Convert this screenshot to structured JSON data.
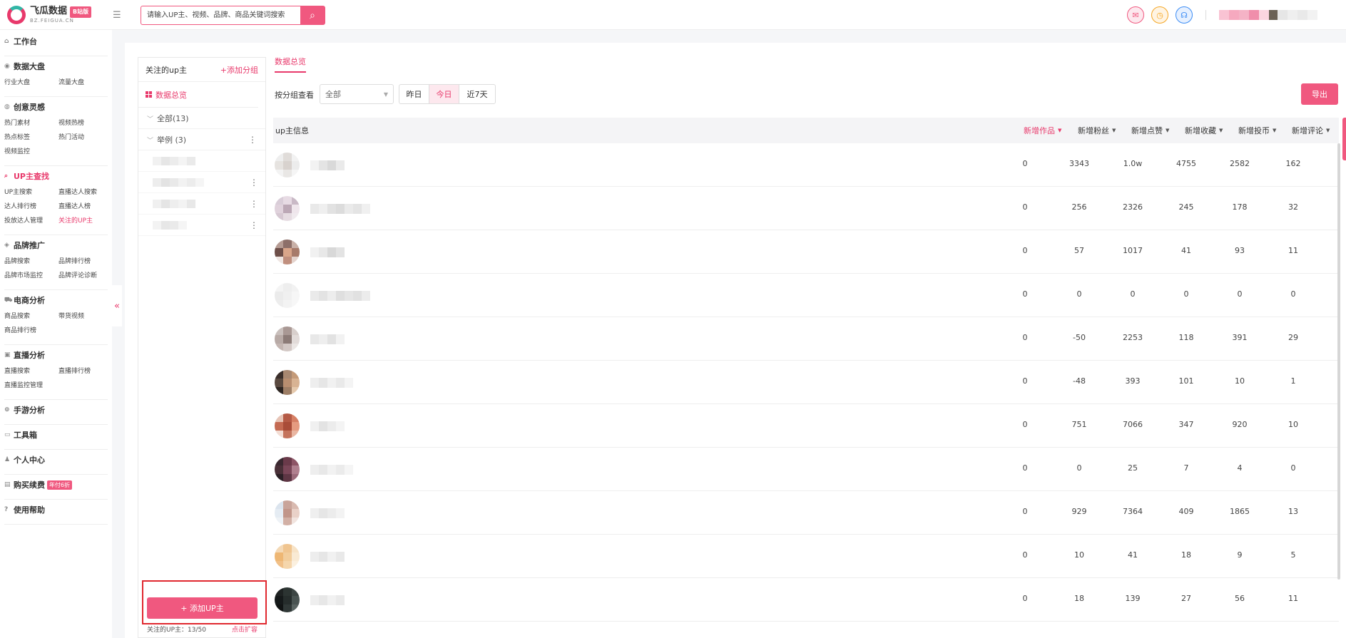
{
  "brand": {
    "name": "飞瓜数据",
    "sub": "BZ.FEIGUA.CN",
    "badge": "B站版"
  },
  "header": {
    "search_placeholder": "请输入UP主、视频、品牌、商品关键词搜索"
  },
  "sidebar": {
    "sections": [
      {
        "title": "工作台",
        "icon": "home-icon",
        "items": []
      },
      {
        "title": "数据大盘",
        "icon": "dashboard-icon",
        "items": [
          "行业大盘",
          "流量大盘"
        ]
      },
      {
        "title": "创意灵感",
        "icon": "bulb-icon",
        "items": [
          "热门素材",
          "视频热榜",
          "热点标签",
          "热门活动",
          "视频监控"
        ]
      },
      {
        "title": "UP主查找",
        "icon": "search-icon",
        "active": true,
        "items": [
          "UP主搜索",
          "直播达人搜索",
          "达人排行榜",
          "直播达人榜",
          "投放达人管理",
          "关注的UP主"
        ],
        "active_item": "关注的UP主"
      },
      {
        "title": "品牌推广",
        "icon": "diamond-icon",
        "items": [
          "品牌搜索",
          "品牌排行榜",
          "品牌市场监控",
          "品牌评论诊断"
        ]
      },
      {
        "title": "电商分析",
        "icon": "cart-icon",
        "items": [
          "商品搜索",
          "带货视频",
          "商品排行榜"
        ]
      },
      {
        "title": "直播分析",
        "icon": "tv-icon",
        "items": [
          "直播搜索",
          "直播排行榜",
          "直播监控管理"
        ]
      },
      {
        "title": "手游分析",
        "icon": "gamepad-icon",
        "items": []
      },
      {
        "title": "工具箱",
        "icon": "toolbox-icon",
        "items": []
      },
      {
        "title": "个人中心",
        "icon": "user-icon",
        "items": []
      },
      {
        "title": "购买续费",
        "icon": "card-icon",
        "badge": "年付6折",
        "items": []
      },
      {
        "title": "使用帮助",
        "icon": "help-icon",
        "items": []
      }
    ]
  },
  "follow_panel": {
    "title": "关注的up主",
    "add_group": "+添加分组",
    "overview": "数据总览",
    "groups": [
      "全部(13)",
      "举例 (3)"
    ],
    "add_up_button": "+ 添加UP主",
    "footer_count": "关注的UP主：13/50",
    "footer_expand": "点击扩容"
  },
  "main": {
    "tab": "数据总览",
    "filter_label": "按分组查看",
    "filter_value": "全部",
    "date_tabs": [
      "昨日",
      "今日",
      "近7天"
    ],
    "date_active": 1,
    "export": "导出",
    "columns": [
      "up主信息",
      "新增作品",
      "新增粉丝",
      "新增点赞",
      "新增收藏",
      "新增投币",
      "新增评论"
    ],
    "active_column": 1,
    "rows": [
      [
        "0",
        "3343",
        "1.0w",
        "4755",
        "2582",
        "162"
      ],
      [
        "0",
        "256",
        "2326",
        "245",
        "178",
        "32"
      ],
      [
        "0",
        "57",
        "1017",
        "41",
        "93",
        "11"
      ],
      [
        "0",
        "0",
        "0",
        "0",
        "0",
        "0"
      ],
      [
        "0",
        "-50",
        "2253",
        "118",
        "391",
        "29"
      ],
      [
        "0",
        "-48",
        "393",
        "101",
        "10",
        "1"
      ],
      [
        "0",
        "751",
        "7066",
        "347",
        "920",
        "10"
      ],
      [
        "0",
        "0",
        "25",
        "7",
        "4",
        "0"
      ],
      [
        "0",
        "929",
        "7364",
        "409",
        "1865",
        "13"
      ],
      [
        "0",
        "10",
        "41",
        "18",
        "9",
        "5"
      ],
      [
        "0",
        "18",
        "139",
        "27",
        "56",
        "11"
      ]
    ]
  },
  "colors": {
    "accent": "#f0587f",
    "accent_dark": "#e8396b",
    "highlight_border": "#e0282f"
  }
}
